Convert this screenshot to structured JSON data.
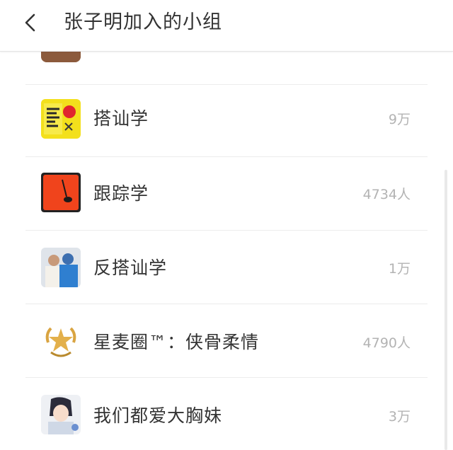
{
  "header": {
    "title": "张子明加入的小组",
    "back_icon": "chevron-left-icon"
  },
  "groups": [
    {
      "name": "",
      "count": "",
      "avatar_icon": "partial-avatar-image"
    },
    {
      "name": "搭讪学",
      "count": "9万",
      "avatar_icon": "yellow-book-cover-image"
    },
    {
      "name": "跟踪学",
      "count": "4734人",
      "avatar_icon": "red-square-image"
    },
    {
      "name": "反搭讪学",
      "count": "1万",
      "avatar_icon": "couple-photo-image"
    },
    {
      "name": "星麦圈™：侠骨柔情",
      "count": "4790人",
      "avatar_icon": "gold-star-emblem-image"
    },
    {
      "name": "我们都爱大胸妹",
      "count": "3万",
      "avatar_icon": "anime-girl-image"
    }
  ],
  "colors": {
    "title_text": "#333333",
    "count_text": "#b3b3b3",
    "divider": "#ececec",
    "red_avatar": "#f0441c"
  }
}
